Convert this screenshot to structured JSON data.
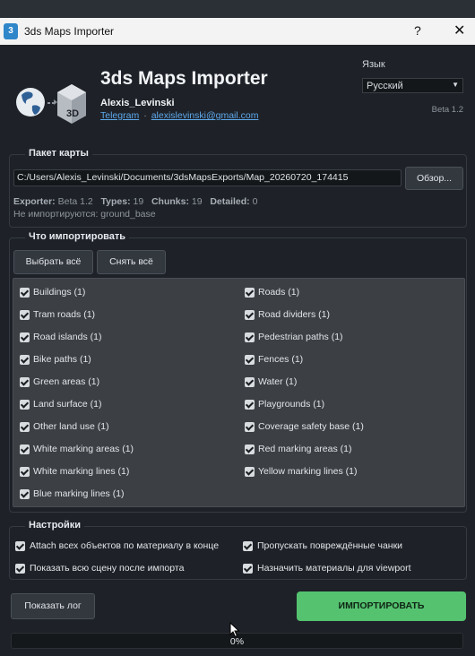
{
  "window": {
    "title": "3ds Maps Importer",
    "help_glyph": "?",
    "close_glyph": "✕"
  },
  "header": {
    "app_title": "3ds Maps Importer",
    "author": "Alexis_Levinski",
    "telegram_link": "Telegram",
    "separator": "·",
    "email_link": "alexislevinski@gmail.com",
    "lang_label": "Язык",
    "lang_value": "Русский",
    "version": "Beta 1.2",
    "logo_badge": "3D"
  },
  "package": {
    "section_title": "Пакет карты",
    "path": "C:/Users/Alexis_Levinski/Documents/3dsMapsExports/Map_20260720_174415",
    "browse_label": "Обзор...",
    "exporter_key": "Exporter:",
    "exporter_value": "Beta 1.2",
    "types_key": "Types:",
    "types_value": "19",
    "chunks_key": "Chunks:",
    "chunks_value": "19",
    "detailed_key": "Detailed:",
    "detailed_value": "0",
    "not_imported": "Не импортируются: ground_base"
  },
  "import_section": {
    "section_title": "Что импортировать",
    "select_all": "Выбрать всё",
    "deselect_all": "Снять всё",
    "items": [
      {
        "label": "Buildings  (1)",
        "checked": true
      },
      {
        "label": "Roads  (1)",
        "checked": true
      },
      {
        "label": "Tram roads  (1)",
        "checked": true
      },
      {
        "label": "Road dividers  (1)",
        "checked": true
      },
      {
        "label": "Road islands  (1)",
        "checked": true
      },
      {
        "label": "Pedestrian paths  (1)",
        "checked": true
      },
      {
        "label": "Bike paths  (1)",
        "checked": true
      },
      {
        "label": "Fences  (1)",
        "checked": true
      },
      {
        "label": "Green areas  (1)",
        "checked": true
      },
      {
        "label": "Water  (1)",
        "checked": true
      },
      {
        "label": "Land surface  (1)",
        "checked": true
      },
      {
        "label": "Playgrounds  (1)",
        "checked": true
      },
      {
        "label": "Other land use  (1)",
        "checked": true
      },
      {
        "label": "Coverage safety base  (1)",
        "checked": true
      },
      {
        "label": "White marking areas  (1)",
        "checked": true
      },
      {
        "label": "Red marking areas  (1)",
        "checked": true
      },
      {
        "label": "White marking lines  (1)",
        "checked": true
      },
      {
        "label": "Yellow marking lines  (1)",
        "checked": true
      },
      {
        "label": "Blue marking lines  (1)",
        "checked": true
      }
    ]
  },
  "settings": {
    "section_title": "Настройки",
    "options": [
      {
        "label": "Attach всех объектов по материалу в конце",
        "checked": true
      },
      {
        "label": "Пропускать повреждённые чанки",
        "checked": true
      },
      {
        "label": "Показать всю сцену после импорта",
        "checked": true
      },
      {
        "label": "Назначить материалы для viewport",
        "checked": true
      }
    ]
  },
  "footer": {
    "log_button": "Показать лог",
    "import_button": "ИМПОРТИРОВАТЬ",
    "progress_text": "0%",
    "progress_value": 0
  },
  "colors": {
    "background": "#1e2228",
    "accent_green": "#55c270",
    "link": "#5ea8ec"
  }
}
